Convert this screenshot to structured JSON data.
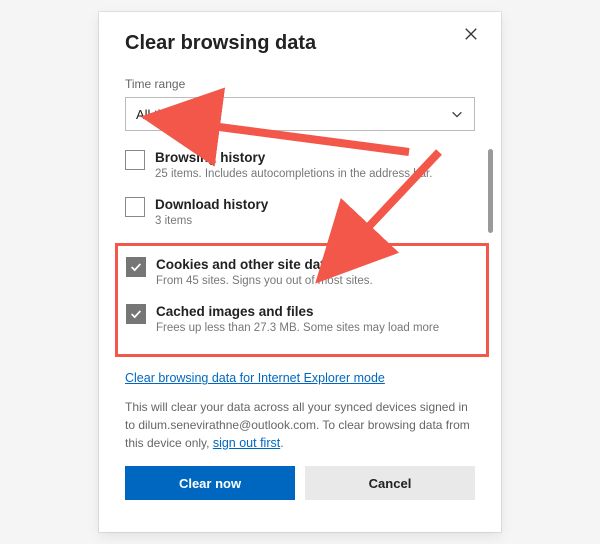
{
  "title": "Clear browsing data",
  "time_range_label": "Time range",
  "time_range_value": "All time",
  "items": [
    {
      "name": "Browsing history",
      "desc": "25 items. Includes autocompletions in the address bar.",
      "checked": false
    },
    {
      "name": "Download history",
      "desc": "3 items",
      "checked": false
    },
    {
      "name": "Cookies and other site data",
      "desc": "From 45 sites. Signs you out of most sites.",
      "checked": true
    },
    {
      "name": "Cached images and files",
      "desc": "Frees up less than 27.3 MB. Some sites may load more",
      "checked": true
    }
  ],
  "ie_link": "Clear browsing data for Internet Explorer mode",
  "footer_prefix": "This will clear your data across all your synced devices signed in to ",
  "footer_email": "dilum.senevirathne@outlook.com",
  "footer_suffix": ". To clear browsing data from this device only, ",
  "footer_link": "sign out first",
  "footer_end": ".",
  "buttons": {
    "primary": "Clear now",
    "secondary": "Cancel"
  },
  "annotation_color": "#f2574a"
}
